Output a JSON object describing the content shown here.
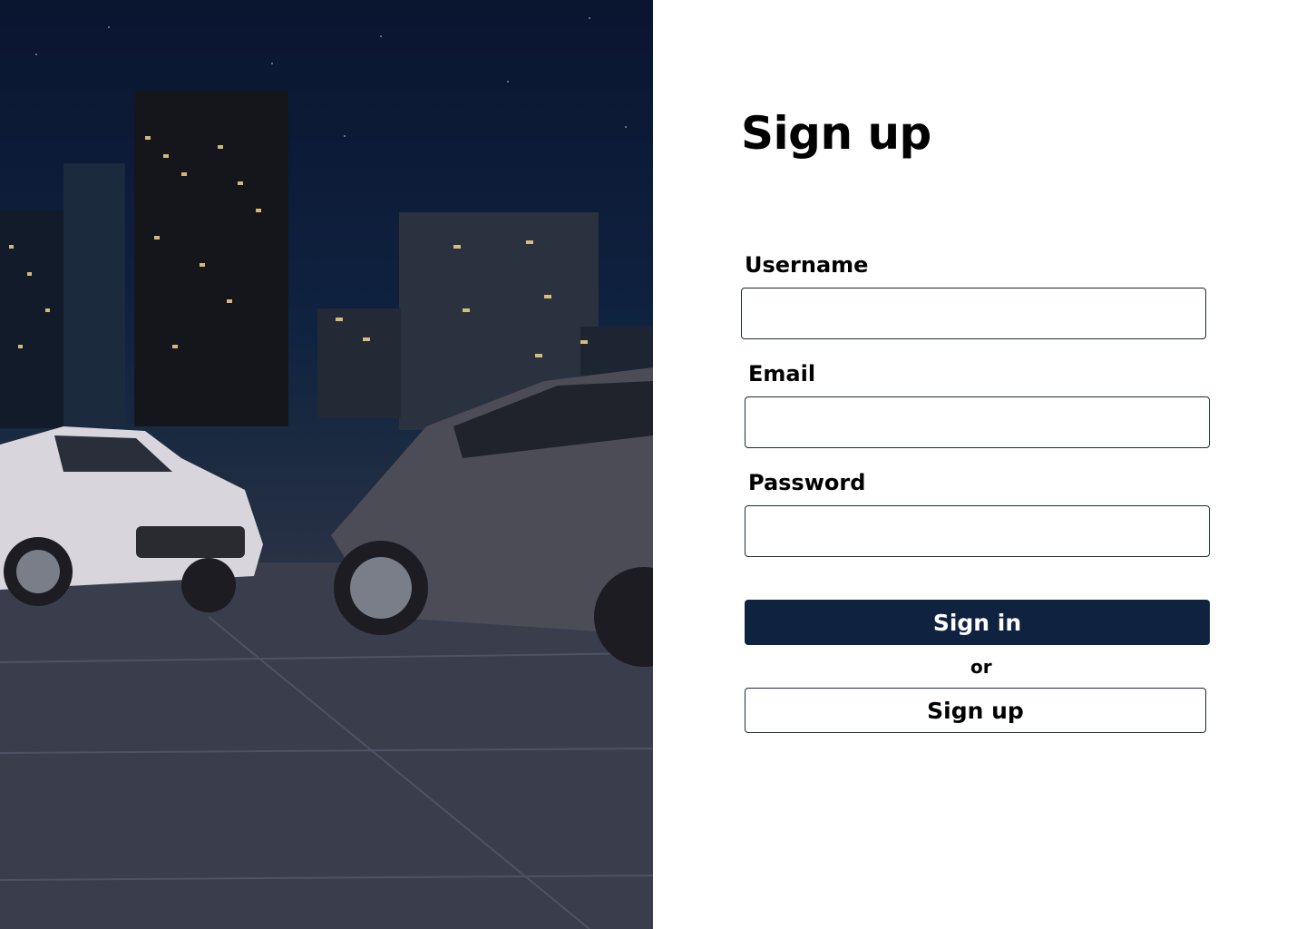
{
  "hero": {
    "image_alt": "Two SUVs parked on a wet plaza in front of a night city skyline"
  },
  "form": {
    "title": "Sign up",
    "username_label": "Username",
    "username_value": "",
    "email_label": "Email",
    "email_value": "",
    "password_label": "Password",
    "password_value": "",
    "signin_label": "Sign in",
    "or_text": "or",
    "signup_label": "Sign up"
  },
  "colors": {
    "primary_button": "#0f2340",
    "input_border": "#1f2a3d"
  }
}
